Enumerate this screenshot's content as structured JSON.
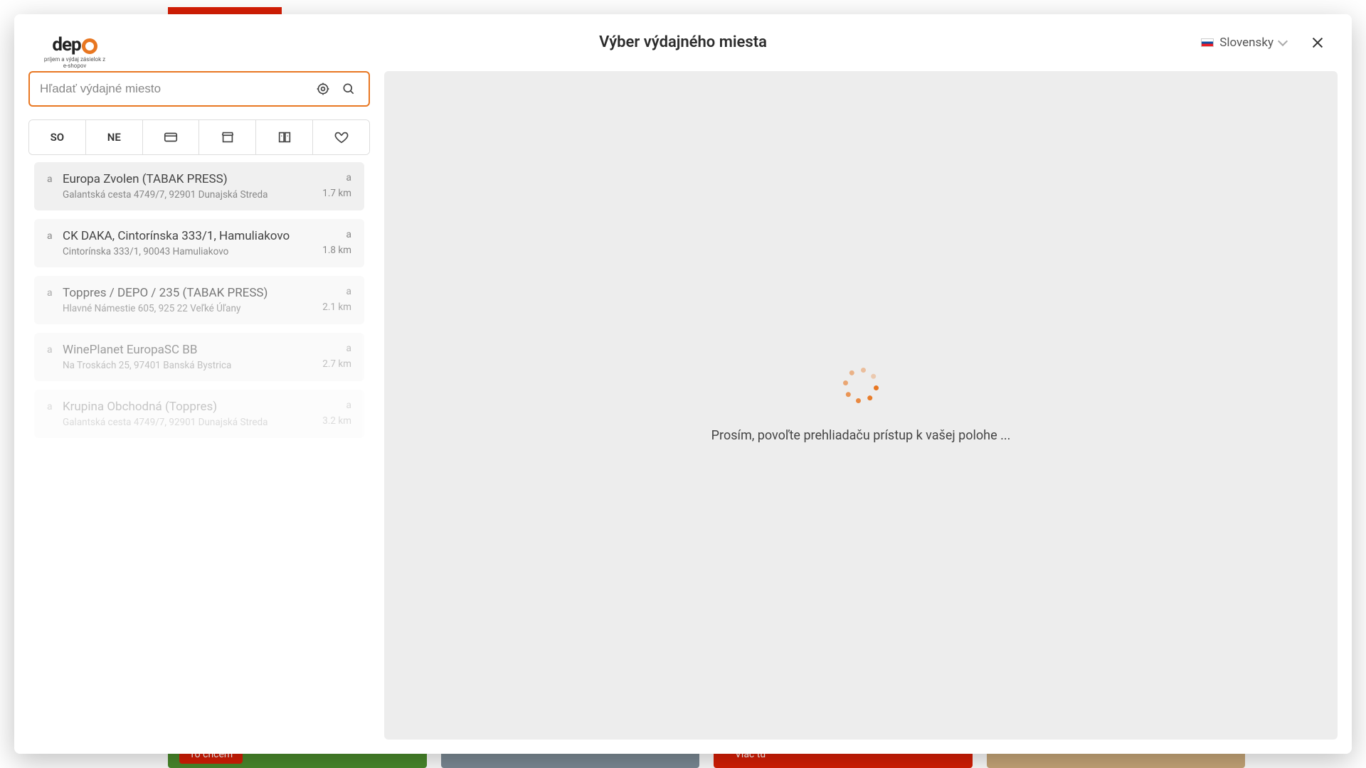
{
  "background": {
    "btn1": "To chcem",
    "btn2": "Viac tu"
  },
  "header": {
    "title": "Výber výdajného miesta",
    "logo_text": "dep",
    "logo_sub": "príjem a výdaj zásielok z e-shopov",
    "language": "Slovensky"
  },
  "search": {
    "placeholder": "Hľadať výdajné miesto"
  },
  "filters": {
    "so": "SO",
    "ne": "NE"
  },
  "status_letter": "a",
  "results": [
    {
      "name": "Europa Zvolen (TABAK PRESS)",
      "address": "Galantská cesta 4749/7, 92901 Dunajská Streda",
      "distance": "1.7 km"
    },
    {
      "name": "CK DAKA, Cintorínska 333/1, Hamuliakovo",
      "address": "Cintorínska 333/1, 90043 Hamuliakovo",
      "distance": "1.8 km"
    },
    {
      "name": "Toppres / DEPO / 235 (TABAK PRESS)",
      "address": "Hlavné Námestie 605, 925 22 Veľké Úľany",
      "distance": "2.1 km"
    },
    {
      "name": "WinePlanet EuropaSC BB",
      "address": "Na Troskách 25, 97401 Banská Bystrica",
      "distance": "2.7 km"
    },
    {
      "name": "Krupina Obchodná (Toppres)",
      "address": "Galantská cesta 4749/7, 92901 Dunajská Streda",
      "distance": "3.2 km"
    }
  ],
  "map": {
    "loading_text": "Prosím, povoľte prehliadaču prístup k vašej polohe ..."
  }
}
